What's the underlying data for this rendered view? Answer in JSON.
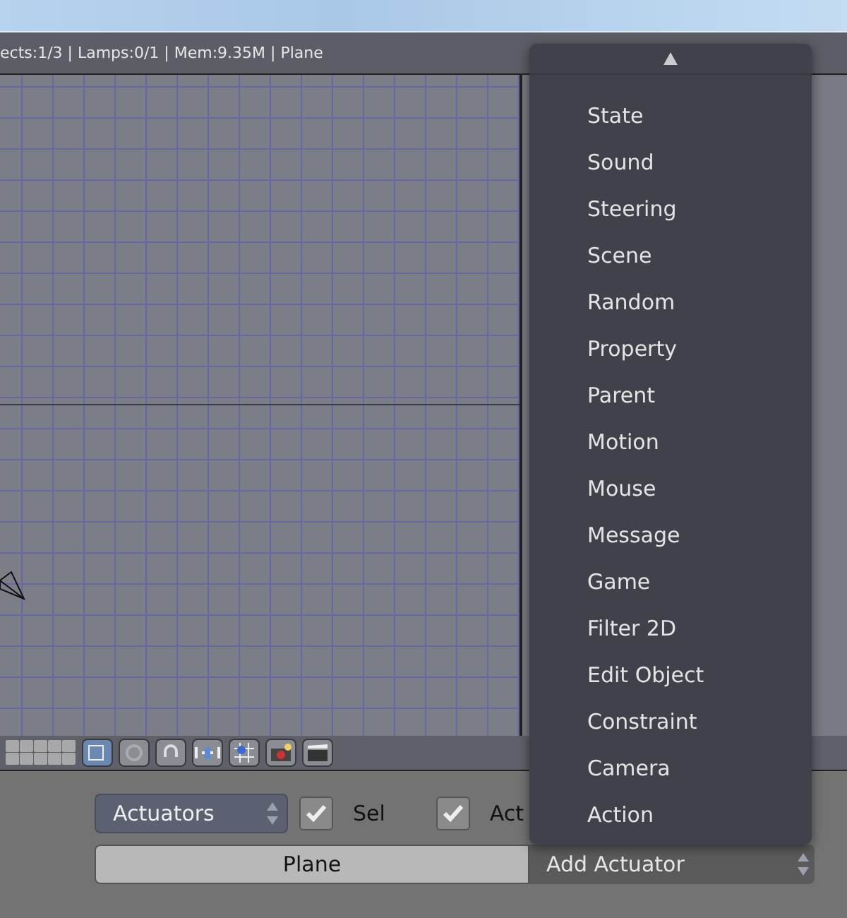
{
  "info_header": {
    "text": "ects:1/3 | Lamps:0/1 | Mem:9.35M | Plane"
  },
  "logic_panel": {
    "type_select": "Actuators",
    "checkboxes": [
      {
        "label": "Sel",
        "checked": true
      },
      {
        "label": "Act",
        "checked": true
      }
    ],
    "object_button": "Plane",
    "add_select": "Add Actuator"
  },
  "dropdown_menu": {
    "items": [
      "State",
      "Sound",
      "Steering",
      "Scene",
      "Random",
      "Property",
      "Parent",
      "Motion",
      "Mouse",
      "Message",
      "Game",
      "Filter 2D",
      "Edit Object",
      "Constraint",
      "Camera",
      "Action"
    ]
  }
}
